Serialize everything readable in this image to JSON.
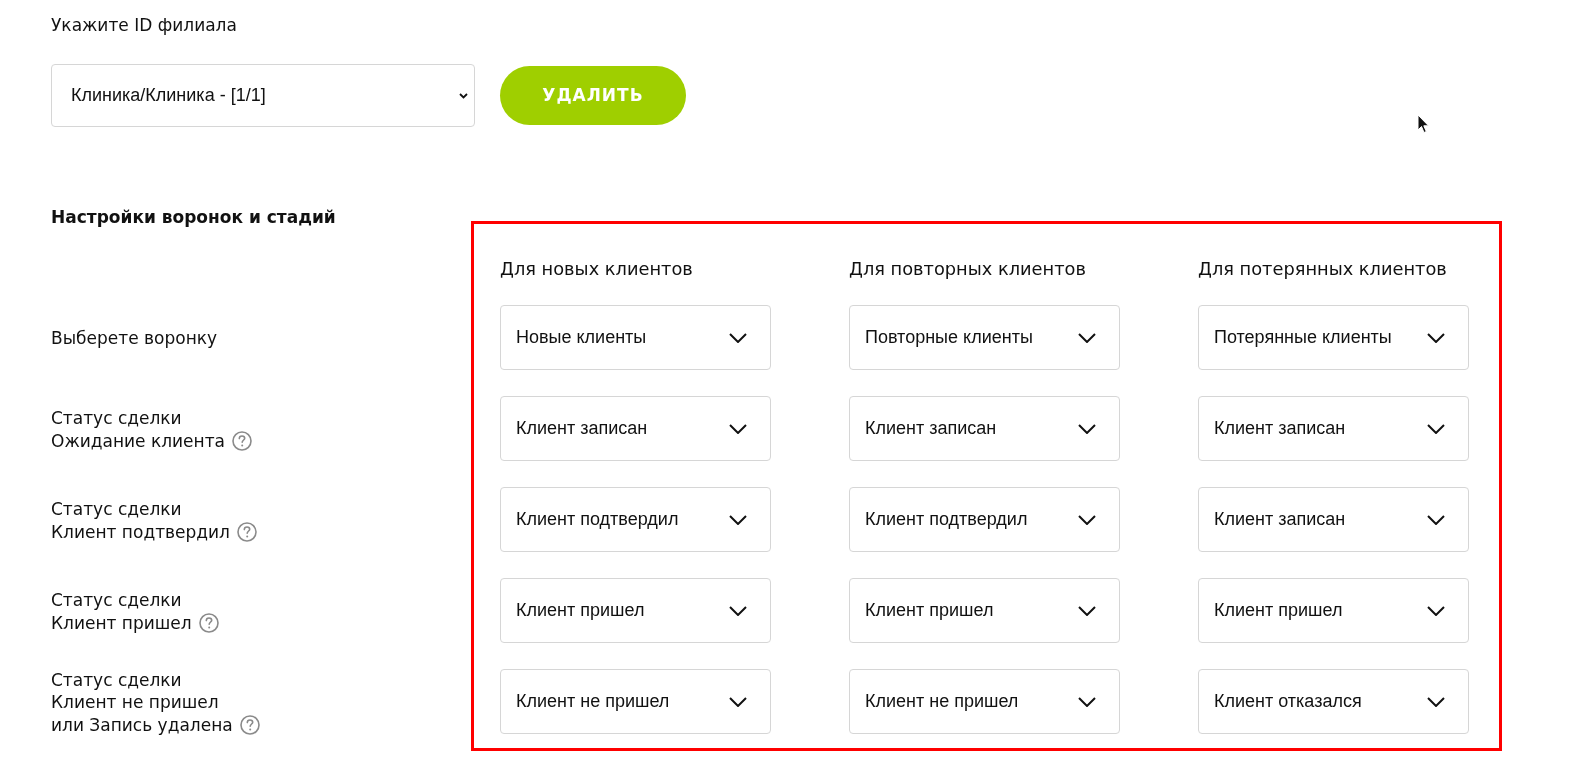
{
  "branch": {
    "label": "Укажите ID филиала",
    "select_value": "Клиника/Клиника - [1/1]",
    "delete_button": "УДАЛИТЬ"
  },
  "funnel_settings": {
    "title": "Настройки воронок и стадий",
    "columns": [
      "Для новых клиентов",
      "Для повторных клиентов",
      "Для потерянных клиентов"
    ],
    "rows": [
      {
        "label_lines": [
          "Выберете воронку"
        ],
        "help_icon": false,
        "values": [
          "Новые клиенты",
          "Повторные клиенты",
          "Потерянные клиенты"
        ]
      },
      {
        "label_lines": [
          "Статус сделки",
          "Ожидание клиента"
        ],
        "help_icon": true,
        "values": [
          "Клиент записан",
          "Клиент записан",
          "Клиент записан"
        ]
      },
      {
        "label_lines": [
          "Статус сделки",
          "Клиент подтвердил"
        ],
        "help_icon": true,
        "values": [
          "Клиент подтвердил",
          "Клиент подтвердил",
          "Клиент записан"
        ]
      },
      {
        "label_lines": [
          "Статус сделки",
          "Клиент пришел"
        ],
        "help_icon": true,
        "values": [
          "Клиент пришел",
          "Клиент пришел",
          "Клиент пришел"
        ]
      },
      {
        "label_lines": [
          "Статус сделки",
          "Клиент не пришел",
          "или Запись удалена"
        ],
        "help_icon": true,
        "values": [
          "Клиент не пришел",
          "Клиент не пришел",
          "Клиент отказался"
        ]
      }
    ]
  }
}
